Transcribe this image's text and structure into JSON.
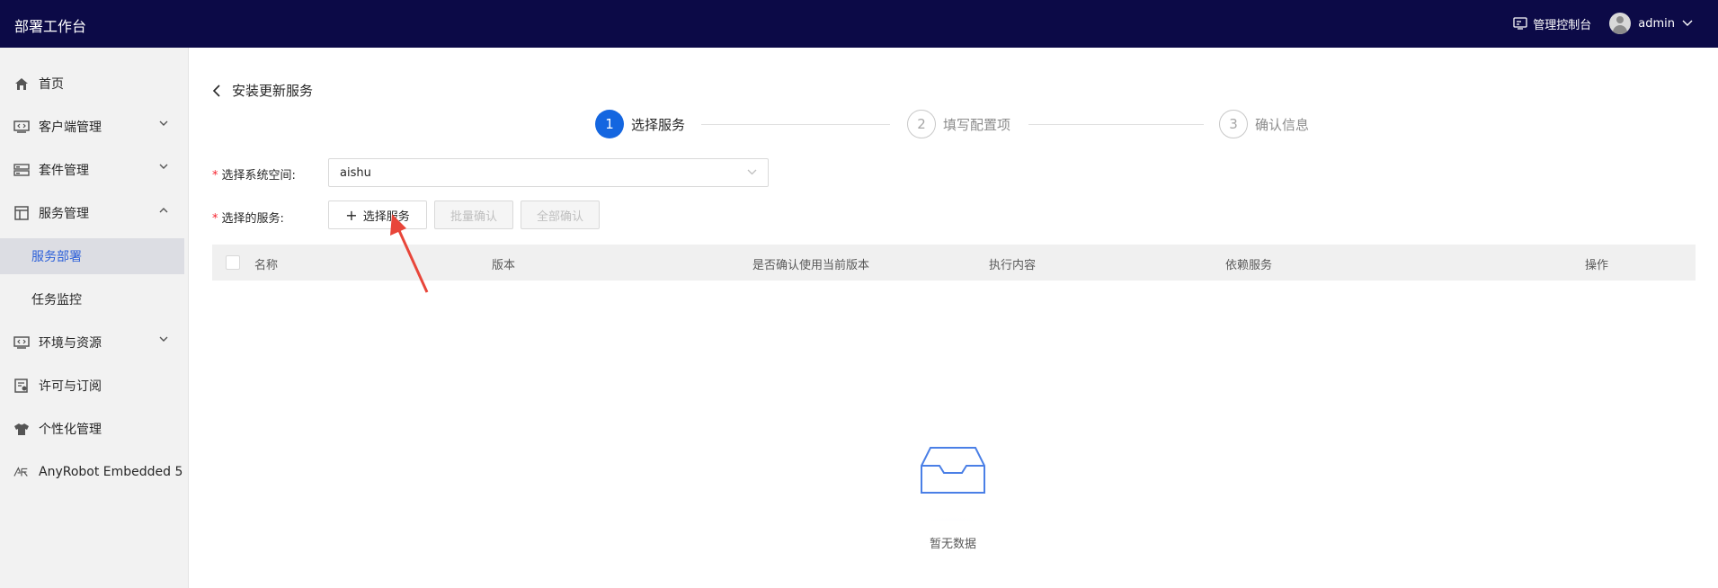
{
  "header": {
    "app_title": "部署工作台",
    "console_label": "管理控制台",
    "user_name": "admin",
    "bg_color": "#0c0a47"
  },
  "sidebar": {
    "items": [
      {
        "label": "首页",
        "icon": "home-icon"
      },
      {
        "label": "客户端管理",
        "icon": "code-window-icon",
        "expandable": true,
        "expanded": false
      },
      {
        "label": "套件管理",
        "icon": "server-rack-icon",
        "expandable": true,
        "expanded": false
      },
      {
        "label": "服务管理",
        "icon": "layout-icon",
        "expandable": true,
        "expanded": true
      },
      {
        "label": "服务部署",
        "sub": true,
        "active": true
      },
      {
        "label": "任务监控",
        "sub": true
      },
      {
        "label": "环境与资源",
        "icon": "code-window-icon",
        "expandable": true,
        "expanded": false
      },
      {
        "label": "许可与订阅",
        "icon": "license-icon"
      },
      {
        "label": "个性化管理",
        "icon": "tshirt-icon"
      },
      {
        "label": "AnyRobot Embedded 5",
        "icon": "anyrobot-logo-icon"
      }
    ]
  },
  "main": {
    "back_title": "安装更新服务",
    "steps": [
      {
        "number": "1",
        "label": "选择服务",
        "status": "active"
      },
      {
        "number": "2",
        "label": "填写配置项",
        "status": "wait"
      },
      {
        "number": "3",
        "label": "确认信息",
        "status": "wait"
      }
    ],
    "form": {
      "space_label": "选择系统空间:",
      "space_value": "aishu",
      "service_label": "选择的服务:",
      "select_service_button": "选择服务",
      "batch_confirm_button": "批量确认",
      "confirm_all_button": "全部确认"
    },
    "table": {
      "columns": [
        "名称",
        "版本",
        "是否确认使用当前版本",
        "执行内容",
        "依赖服务",
        "操作"
      ]
    },
    "empty_text": "暂无数据"
  },
  "colors": {
    "accent": "#1466e0",
    "active_menu_bg": "#dcdde3",
    "active_menu_text": "#2b5fd9",
    "annotation_arrow": "#e8463a"
  }
}
